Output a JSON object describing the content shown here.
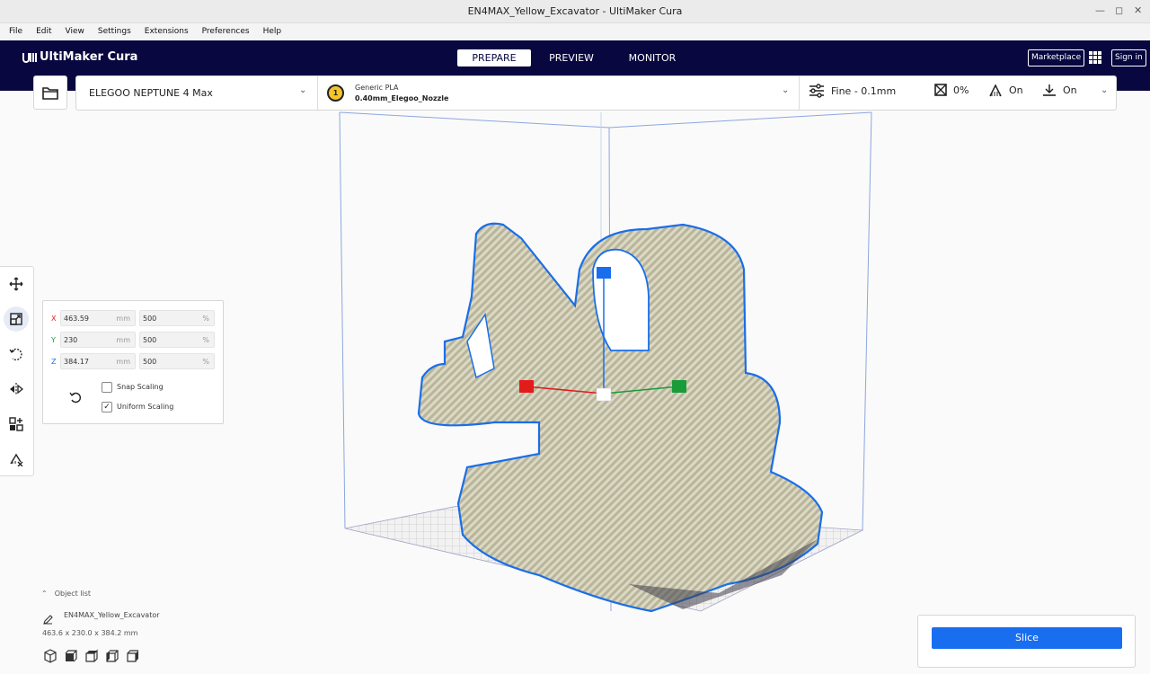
{
  "window": {
    "title": "EN4MAX_Yellow_Excavator - UltiMaker Cura"
  },
  "menu": [
    "File",
    "Edit",
    "View",
    "Settings",
    "Extensions",
    "Preferences",
    "Help"
  ],
  "header": {
    "logo_text": "UltiMaker Cura",
    "stages": [
      "PREPARE",
      "PREVIEW",
      "MONITOR"
    ],
    "active_stage": "PREPARE",
    "marketplace_label": "Marketplace",
    "signin_label": "Sign in"
  },
  "printer": {
    "name": "ELEGOO NEPTUNE 4 Max"
  },
  "extruder": {
    "number": "1",
    "material": "Generic PLA",
    "nozzle": "0.40mm_Elegoo_Nozzle",
    "color": "#f3c52a"
  },
  "print_settings": {
    "profile": "Fine - 0.1mm",
    "infill": "0%",
    "support": "On",
    "adhesion": "On"
  },
  "tools": [
    "move-tool",
    "scale-tool",
    "rotate-tool",
    "mirror-tool",
    "per-model-settings-tool",
    "support-blocker-tool"
  ],
  "scale_panel": {
    "x": {
      "axis": "X",
      "mm": "463.59",
      "mm_unit": "mm",
      "pct": "500",
      "pct_unit": "%"
    },
    "y": {
      "axis": "Y",
      "mm": "230",
      "mm_unit": "mm",
      "pct": "500",
      "pct_unit": "%"
    },
    "z": {
      "axis": "Z",
      "mm": "384.17",
      "mm_unit": "mm",
      "pct": "500",
      "pct_unit": "%"
    },
    "snap_scaling": {
      "label": "Snap Scaling",
      "checked": false
    },
    "uniform_scaling": {
      "label": "Uniform Scaling",
      "checked": true
    }
  },
  "object_list": {
    "title": "Object list",
    "object_name": "EN4MAX_Yellow_Excavator",
    "dimensions": "463.6 x 230.0 x 384.2 mm"
  },
  "slice": {
    "label": "Slice"
  },
  "colors": {
    "header_bg": "#08073f",
    "accent": "#196ef0",
    "axis_x": "#e21b1b",
    "axis_y": "#1a9b3a",
    "axis_z": "#196ef0"
  }
}
